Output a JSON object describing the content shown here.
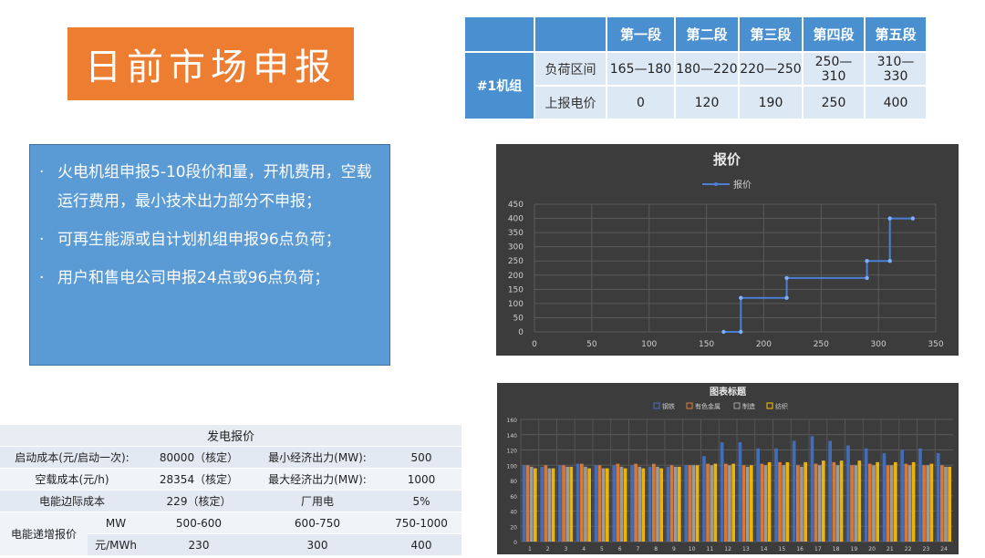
{
  "title": "日前市场申报",
  "segment_table": {
    "headers": [
      "第一段",
      "第二段",
      "第三段",
      "第四段",
      "第五段"
    ],
    "unit_label": "#1机组",
    "rows": [
      {
        "label": "负荷区间",
        "values": [
          "165—180",
          "180—220",
          "220—250",
          "250—310",
          "310—330"
        ]
      },
      {
        "label": "上报电价",
        "values": [
          "0",
          "120",
          "190",
          "250",
          "400"
        ]
      }
    ]
  },
  "bullets": [
    "火电机组申报5-10段价和量，开机费用，空载运行费用，最小技术出力部分不申报；",
    "可再生能源或自计划机组申报96点负荷；",
    "用户和售电公司申报24点或96点负荷；"
  ],
  "bullet_glyph": "·",
  "cost_table": {
    "title": "发电报价",
    "rows": [
      [
        "启动成本(元/启动一次):",
        "80000（核定）",
        "最小经济出力(MW):",
        "500"
      ],
      [
        "空载成本(元/h)",
        "28354（核定）",
        "最大经济出力(MW):",
        "1000"
      ],
      [
        "电能边际成本",
        "229（核定）",
        "厂用电",
        "5%"
      ]
    ],
    "incr_label": "电能递增报价",
    "mw_label": "MW",
    "price_label": "元/MWh",
    "mw_values": [
      "500-600",
      "600-750",
      "750-1000"
    ],
    "price_values": [
      "230",
      "300",
      "400"
    ]
  },
  "chart_data": [
    {
      "type": "line",
      "title": "报价",
      "legend": [
        "报价"
      ],
      "legend_position": "top",
      "series": [
        {
          "name": "报价",
          "points": [
            [
              165,
              0
            ],
            [
              180,
              0
            ],
            [
              180,
              120
            ],
            [
              220,
              120
            ],
            [
              220,
              190
            ],
            [
              290,
              190
            ],
            [
              290,
              250
            ],
            [
              310,
              250
            ],
            [
              310,
              400
            ],
            [
              330,
              400
            ]
          ]
        }
      ],
      "xlim": [
        0,
        350
      ],
      "ylim": [
        0,
        450
      ],
      "xticks": [
        0,
        50,
        100,
        150,
        200,
        250,
        300,
        350
      ],
      "yticks": [
        0,
        50,
        100,
        150,
        200,
        250,
        300,
        350,
        400,
        450
      ],
      "grid": true,
      "color": "#4a7fd4"
    },
    {
      "type": "bar",
      "title": "图表标题",
      "legend_position": "top",
      "categories": [
        "1",
        "2",
        "3",
        "4",
        "5",
        "6",
        "7",
        "8",
        "9",
        "10",
        "11",
        "12",
        "13",
        "14",
        "15",
        "16",
        "17",
        "18",
        "19",
        "20",
        "21",
        "22",
        "23",
        "24"
      ],
      "ylim": [
        0,
        160
      ],
      "yticks": [
        0,
        20,
        40,
        60,
        80,
        100,
        120,
        140,
        160
      ],
      "grid": true,
      "series": [
        {
          "name": "钢铁",
          "color": "#4472c4",
          "values": [
            100,
            98,
            100,
            102,
            100,
            100,
            100,
            98,
            98,
            100,
            112,
            130,
            130,
            122,
            122,
            132,
            138,
            132,
            126,
            122,
            116,
            120,
            122,
            116
          ]
        },
        {
          "name": "有色金属",
          "color": "#ed7d31",
          "values": [
            100,
            100,
            100,
            102,
            100,
            102,
            102,
            102,
            100,
            100,
            102,
            102,
            100,
            102,
            104,
            100,
            102,
            104,
            100,
            102,
            100,
            102,
            100,
            100
          ]
        },
        {
          "name": "制造",
          "color": "#a5a5a5",
          "values": [
            98,
            96,
            98,
            98,
            96,
            98,
            98,
            98,
            98,
            100,
            100,
            100,
            98,
            100,
            100,
            98,
            100,
            100,
            100,
            100,
            100,
            100,
            100,
            98
          ]
        },
        {
          "name": "纺织",
          "color": "#ffc000",
          "values": [
            96,
            96,
            98,
            96,
            96,
            96,
            96,
            96,
            98,
            100,
            102,
            102,
            100,
            104,
            104,
            104,
            106,
            106,
            106,
            104,
            104,
            104,
            102,
            98
          ]
        }
      ]
    }
  ]
}
